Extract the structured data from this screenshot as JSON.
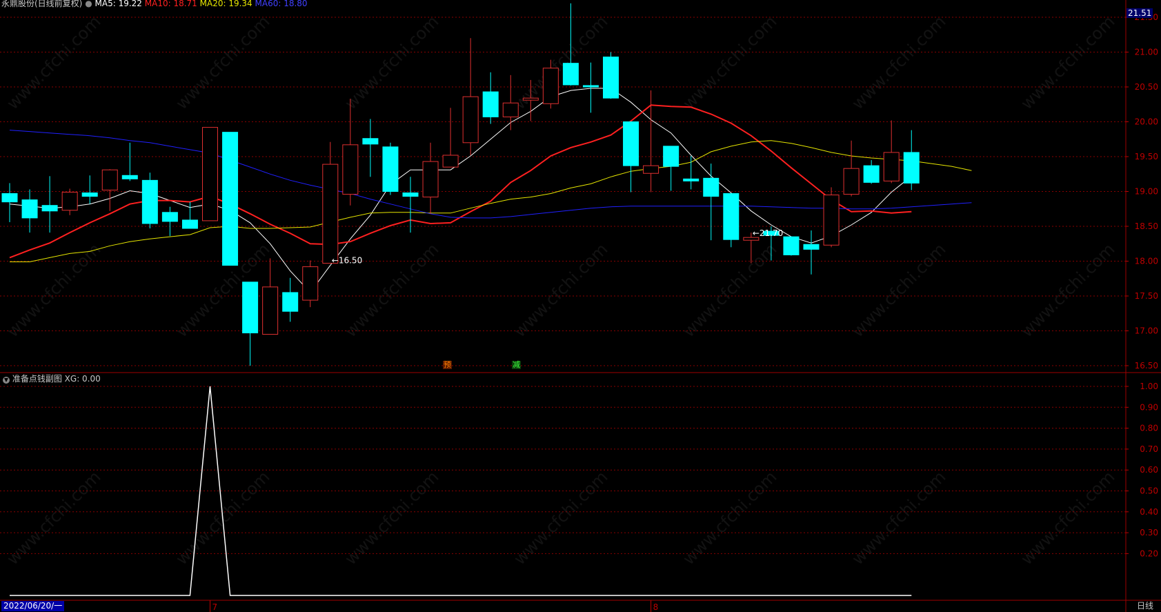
{
  "header": {
    "title": "永鼎股份(日线前复权)",
    "ma_label": "MA5: 19.22",
    "ma10_label": "MA10: 18.71",
    "ma20_label": "MA20: 19.34",
    "ma60_label": "MA60: 18.80"
  },
  "sub_header": {
    "indicator_name": "准备点钱副图",
    "xg_label": "XG: 0.00"
  },
  "bottom_bar": {
    "date": "2022/06/20/一",
    "period": "日线",
    "month_marks": [
      "7",
      "8"
    ]
  },
  "markers": {
    "yu": "预",
    "jian": "减"
  },
  "watermark": "www.cfchi.com",
  "colors": {
    "up": "#e03030",
    "down": "#00ffff",
    "ma5": "#ffffff",
    "ma10": "#ff2020",
    "ma20": "#e6e600",
    "ma60": "#2020ff",
    "grid": "#8b0000",
    "axis_text": "#c00000",
    "indicator": "#ffffff"
  },
  "chart_data": [
    {
      "type": "candlestick",
      "title": "",
      "ylim": [
        16.3,
        21.8
      ],
      "y_ticks": [
        16.5,
        17.0,
        17.5,
        18.0,
        18.5,
        19.0,
        19.5,
        20.0,
        20.5,
        21.0,
        21.5
      ],
      "current_price": "21.51",
      "annotations": [
        {
          "label": "21.70",
          "index": 37
        },
        {
          "label": "16.50",
          "index": 16
        }
      ],
      "candles": [
        {
          "o": 18.97,
          "h": 19.12,
          "l": 18.56,
          "c": 18.85
        },
        {
          "o": 18.88,
          "h": 19.03,
          "l": 18.41,
          "c": 18.62
        },
        {
          "o": 18.8,
          "h": 19.22,
          "l": 18.41,
          "c": 18.72
        },
        {
          "o": 18.73,
          "h": 19.04,
          "l": 18.66,
          "c": 18.99
        },
        {
          "o": 18.98,
          "h": 19.23,
          "l": 18.82,
          "c": 18.93
        },
        {
          "o": 19.02,
          "h": 19.32,
          "l": 18.72,
          "c": 19.31
        },
        {
          "o": 19.23,
          "h": 19.7,
          "l": 19.15,
          "c": 19.18
        },
        {
          "o": 19.16,
          "h": 19.27,
          "l": 18.47,
          "c": 18.54
        },
        {
          "o": 18.7,
          "h": 18.78,
          "l": 18.36,
          "c": 18.57
        },
        {
          "o": 18.59,
          "h": 18.85,
          "l": 18.47,
          "c": 18.47
        },
        {
          "o": 18.58,
          "h": 19.92,
          "l": 18.58,
          "c": 19.92
        },
        {
          "o": 19.85,
          "h": 19.85,
          "l": 17.94,
          "c": 17.94
        },
        {
          "o": 17.7,
          "h": 17.7,
          "l": 16.5,
          "c": 16.97
        },
        {
          "o": 16.95,
          "h": 18.04,
          "l": 16.95,
          "c": 17.63
        },
        {
          "o": 17.55,
          "h": 17.76,
          "l": 17.13,
          "c": 17.28
        },
        {
          "o": 17.44,
          "h": 18.01,
          "l": 17.34,
          "c": 17.92
        },
        {
          "o": 17.97,
          "h": 19.71,
          "l": 17.97,
          "c": 19.39
        },
        {
          "o": 18.96,
          "h": 20.33,
          "l": 18.8,
          "c": 19.67
        },
        {
          "o": 19.76,
          "h": 20.04,
          "l": 19.21,
          "c": 19.68
        },
        {
          "o": 19.64,
          "h": 19.7,
          "l": 18.95,
          "c": 19.0
        },
        {
          "o": 18.98,
          "h": 19.21,
          "l": 18.41,
          "c": 18.93
        },
        {
          "o": 18.92,
          "h": 19.7,
          "l": 18.68,
          "c": 19.43
        },
        {
          "o": 19.35,
          "h": 20.2,
          "l": 19.35,
          "c": 19.52
        },
        {
          "o": 19.7,
          "h": 21.2,
          "l": 19.52,
          "c": 20.36
        },
        {
          "o": 20.43,
          "h": 20.71,
          "l": 19.97,
          "c": 20.07
        },
        {
          "o": 20.07,
          "h": 20.67,
          "l": 19.88,
          "c": 20.27
        },
        {
          "o": 20.31,
          "h": 20.6,
          "l": 20.01,
          "c": 20.34
        },
        {
          "o": 20.26,
          "h": 20.89,
          "l": 20.19,
          "c": 20.77
        },
        {
          "o": 20.84,
          "h": 21.7,
          "l": 20.52,
          "c": 20.53
        },
        {
          "o": 20.52,
          "h": 20.85,
          "l": 20.13,
          "c": 20.5
        },
        {
          "o": 20.93,
          "h": 21.0,
          "l": 20.33,
          "c": 20.34
        },
        {
          "o": 20.0,
          "h": 20.0,
          "l": 18.99,
          "c": 19.37
        },
        {
          "o": 19.26,
          "h": 20.45,
          "l": 18.99,
          "c": 19.37
        },
        {
          "o": 19.65,
          "h": 19.65,
          "l": 19.01,
          "c": 19.36
        },
        {
          "o": 19.18,
          "h": 19.51,
          "l": 19.03,
          "c": 19.15
        },
        {
          "o": 19.19,
          "h": 19.4,
          "l": 18.3,
          "c": 18.93
        },
        {
          "o": 18.97,
          "h": 18.97,
          "l": 18.2,
          "c": 18.31
        },
        {
          "o": 18.3,
          "h": 18.41,
          "l": 17.97,
          "c": 18.34
        },
        {
          "o": 18.43,
          "h": 18.5,
          "l": 18.01,
          "c": 18.37
        },
        {
          "o": 18.35,
          "h": 18.35,
          "l": 18.08,
          "c": 18.09
        },
        {
          "o": 18.24,
          "h": 18.44,
          "l": 17.81,
          "c": 18.17
        },
        {
          "o": 18.23,
          "h": 19.06,
          "l": 18.2,
          "c": 18.95
        },
        {
          "o": 18.96,
          "h": 19.73,
          "l": 18.93,
          "c": 19.33
        },
        {
          "o": 19.37,
          "h": 19.45,
          "l": 19.11,
          "c": 19.13
        },
        {
          "o": 19.15,
          "h": 20.02,
          "l": 19.12,
          "c": 19.56
        },
        {
          "o": 19.56,
          "h": 19.88,
          "l": 19.02,
          "c": 19.12
        }
      ],
      "series": [
        {
          "name": "MA5",
          "values": [
            18.82,
            18.79,
            18.76,
            18.78,
            18.82,
            18.9,
            19.01,
            18.97,
            18.87,
            18.77,
            18.82,
            18.73,
            18.55,
            18.25,
            17.86,
            17.55,
            17.94,
            18.32,
            18.66,
            19.1,
            19.31,
            19.31,
            19.31,
            19.51,
            19.75,
            19.99,
            20.15,
            20.36,
            20.45,
            20.48,
            20.48,
            20.28,
            20.03,
            19.84,
            19.52,
            19.22,
            18.98,
            18.72,
            18.52,
            18.35,
            18.26,
            18.36,
            18.52,
            18.7,
            18.99,
            19.22
          ]
        },
        {
          "name": "MA10",
          "values": [
            18.05,
            18.16,
            18.26,
            18.41,
            18.55,
            18.68,
            18.82,
            18.87,
            18.87,
            18.85,
            18.93,
            18.82,
            18.68,
            18.53,
            18.4,
            18.25,
            18.24,
            18.28,
            18.4,
            18.51,
            18.59,
            18.54,
            18.55,
            18.71,
            18.86,
            19.13,
            19.3,
            19.51,
            19.63,
            19.71,
            19.81,
            20.01,
            20.24,
            20.22,
            20.21,
            20.11,
            19.98,
            19.8,
            19.58,
            19.34,
            19.11,
            18.88,
            18.71,
            18.72,
            18.69,
            18.71
          ]
        },
        {
          "name": "MA20",
          "values": [
            17.99,
            17.99,
            18.05,
            18.11,
            18.14,
            18.22,
            18.28,
            18.32,
            18.35,
            18.38,
            18.48,
            18.5,
            18.47,
            18.47,
            18.48,
            18.49,
            18.56,
            18.63,
            18.69,
            18.7,
            18.7,
            18.69,
            18.69,
            18.76,
            18.83,
            18.89,
            18.92,
            18.97,
            19.05,
            19.11,
            19.21,
            19.29,
            19.33,
            19.36,
            19.42,
            19.57,
            19.65,
            19.71,
            19.73,
            19.69,
            19.63,
            19.56,
            19.51,
            19.48,
            19.46,
            19.44,
            19.4,
            19.36,
            19.3
          ]
        },
        {
          "name": "MA60",
          "values": [
            19.88,
            19.86,
            19.84,
            19.82,
            19.8,
            19.77,
            19.73,
            19.7,
            19.65,
            19.6,
            19.55,
            19.45,
            19.35,
            19.25,
            19.16,
            19.09,
            19.03,
            18.97,
            18.89,
            18.82,
            18.75,
            18.68,
            18.63,
            18.62,
            18.62,
            18.64,
            18.67,
            18.7,
            18.73,
            18.76,
            18.78,
            18.79,
            18.79,
            18.79,
            18.79,
            18.79,
            18.79,
            18.79,
            18.78,
            18.77,
            18.76,
            18.76,
            18.75,
            18.75,
            18.76,
            18.78,
            18.8,
            18.82,
            18.84
          ]
        }
      ]
    },
    {
      "type": "line",
      "title": "准备点钱副图",
      "ylim": [
        0,
        1.0
      ],
      "y_ticks": [
        1.0,
        0.9,
        0.8,
        0.7,
        0.6,
        0.5,
        0.4,
        0.3,
        0.2
      ],
      "series": [
        {
          "name": "XG",
          "values": [
            0,
            0,
            0,
            0,
            0,
            0,
            0,
            0,
            0,
            0,
            1,
            0,
            0,
            0,
            0,
            0,
            0,
            0,
            0,
            0,
            0,
            0,
            0,
            0,
            0,
            0,
            0,
            0,
            0,
            0,
            0,
            0,
            0,
            0,
            0,
            0,
            0,
            0,
            0,
            0,
            0,
            0,
            0,
            0,
            0,
            0
          ]
        }
      ]
    }
  ]
}
